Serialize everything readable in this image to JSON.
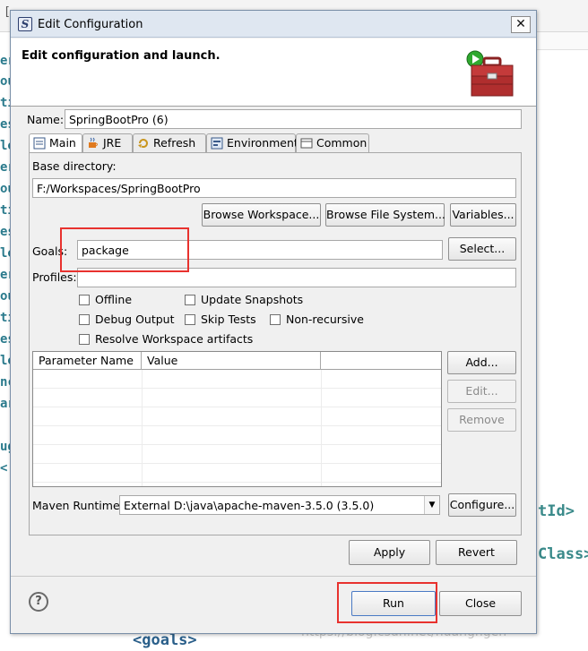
{
  "background": {
    "top_bracket": "[",
    "left_fragments": [
      "er",
      "ou",
      "ti",
      "es",
      "le",
      "er",
      "ou",
      "ti",
      "es",
      "le",
      "er",
      "ou",
      "ti",
      "es",
      "le",
      "nc",
      "ar",
      "ug",
      "<"
    ],
    "xml_fragment_1": "tId>",
    "xml_fragment_2": "Class>",
    "xml_fragment_3": "<goals>",
    "watermark": "https://blog.csdn.net/huangngen"
  },
  "dialog": {
    "title": "Edit Configuration",
    "close_glyph": "✕",
    "banner_title": "Edit configuration and launch.",
    "name_label": "Name:",
    "name_value": "SpringBootPro (6)",
    "tabs": [
      "Main",
      "JRE",
      "Refresh",
      "Environment",
      "Common"
    ],
    "base_directory_label": "Base directory:",
    "base_directory_value": "F:/Workspaces/SpringBootPro",
    "browse_workspace_label": "Browse Workspace...",
    "browse_file_system_label": "Browse File System...",
    "variables_label": "Variables...",
    "goals_label": "Goals:",
    "goals_value": "package",
    "select_label": "Select...",
    "profiles_label": "Profiles:",
    "profiles_value": "",
    "checkboxes": {
      "offline": "Offline",
      "update_snapshots": "Update Snapshots",
      "debug_output": "Debug Output",
      "skip_tests": "Skip Tests",
      "non_recursive": "Non-recursive",
      "resolve_workspace": "Resolve Workspace artifacts"
    },
    "param_table": {
      "columns": [
        "Parameter Name",
        "Value",
        ""
      ],
      "rows": []
    },
    "add_label": "Add...",
    "edit_label": "Edit...",
    "remove_label": "Remove",
    "maven_runtime_label": "Maven Runtime:",
    "maven_runtime_value": "External D:\\java\\apache-maven-3.5.0 (3.5.0)",
    "configure_label": "Configure...",
    "apply_label": "Apply",
    "revert_label": "Revert",
    "help_glyph": "?",
    "run_label": "Run",
    "close_label": "Close"
  },
  "colors": {
    "highlight_box": "#e8322e",
    "code_teal": "#2a7a8c"
  },
  "icons": [
    "app-logo-icon",
    "toolbox-run-icon",
    "main-tab-icon",
    "jre-tab-icon",
    "refresh-tab-icon",
    "environment-tab-icon",
    "common-tab-icon",
    "help-icon",
    "dropdown-arrow-icon"
  ]
}
